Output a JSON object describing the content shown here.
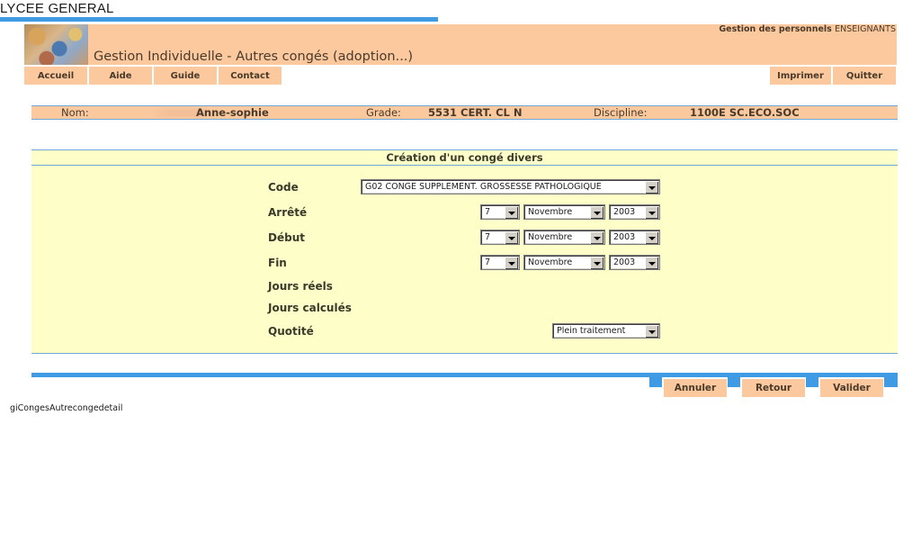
{
  "app": {
    "school": "LYCEE GENERAL",
    "subtitle_bold": "Gestion des personnels",
    "subtitle_light": "ENSEIGNANTS",
    "page_title": "Gestion Individuelle - Autres congés (adoption...)"
  },
  "nav": {
    "left": [
      "Accueil",
      "Aide",
      "Guide",
      "Contact"
    ],
    "right": [
      "Imprimer",
      "Quitter"
    ]
  },
  "identity": {
    "nom_label": "Nom:",
    "nom_value": "Anne-sophie",
    "grade_label": "Grade:",
    "grade_value": "5531 CERT. CL N",
    "discipline_label": "Discipline:",
    "discipline_value": "1100E SC.ECO.SOC"
  },
  "form": {
    "title": "Création d'un congé divers",
    "code_label": "Code",
    "code_value": "G02 CONGE SUPPLEMENT. GROSSESSE PATHOLOGIQUE",
    "arrete_label": "Arrêté",
    "arrete": {
      "day": "7",
      "month": "Novembre",
      "year": "2003"
    },
    "debut_label": "Début",
    "debut": {
      "day": "7",
      "month": "Novembre",
      "year": "2003"
    },
    "fin_label": "Fin",
    "fin": {
      "day": "7",
      "month": "Novembre",
      "year": "2003"
    },
    "jours_reels_label": "Jours réels",
    "jours_calcules_label": "Jours calculés",
    "quotite_label": "Quotité",
    "quotite_value": "Plein traitement"
  },
  "actions": [
    "Annuler",
    "Retour",
    "Valider"
  ],
  "footer": {
    "page_id": "giCongesAutrecongedetail"
  },
  "colors": {
    "accent_blue": "#3f9be3",
    "header_peach": "#fcc99f",
    "form_yellow": "#fefec9"
  }
}
